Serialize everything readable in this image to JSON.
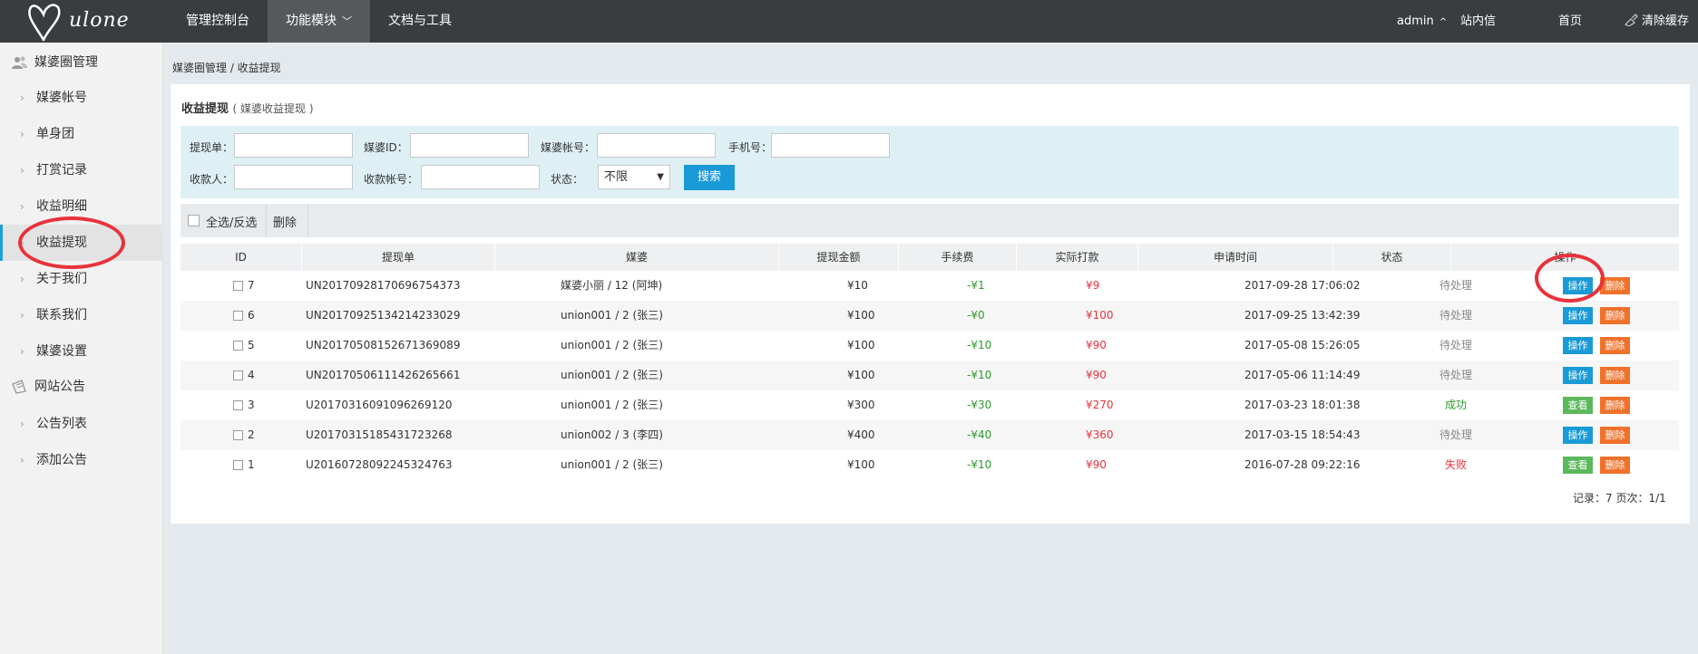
{
  "header": {
    "logo_text": "ulone",
    "nav": [
      {
        "label": "管理控制台"
      },
      {
        "label": "功能模块"
      },
      {
        "label": "文档与工具"
      }
    ],
    "user": "admin",
    "inbox": "站内信",
    "home": "首页",
    "clear_cache": "清除缓存"
  },
  "sidebar": {
    "group1": "媒婆圈管理",
    "items1": [
      {
        "label": "媒婆帐号"
      },
      {
        "label": "单身团"
      },
      {
        "label": "打赏记录"
      },
      {
        "label": "收益明细"
      },
      {
        "label": "收益提现"
      },
      {
        "label": "关于我们"
      },
      {
        "label": "联系我们"
      },
      {
        "label": "媒婆设置"
      }
    ],
    "group2": "网站公告",
    "items2": [
      {
        "label": "公告列表"
      },
      {
        "label": "添加公告"
      }
    ]
  },
  "breadcrumb": "媒婆圈管理 / 收益提现",
  "panel": {
    "title": "收益提现",
    "subtitle": "( 媒婆收益提现 )"
  },
  "filter": {
    "order_label": "提现单：",
    "id_label": "媒婆ID：",
    "account_label": "媒婆帐号：",
    "phone_label": "手机号：",
    "payee_label": "收款人：",
    "payee_account_label": "收款帐号：",
    "status_label": "状态：",
    "status_value": "不限",
    "search_label": "搜索"
  },
  "toolbar": {
    "select_all": "全选/反选",
    "delete": "删除"
  },
  "table": {
    "headers": [
      "ID",
      "提现单",
      "媒婆",
      "提现金额",
      "手续费",
      "实际打款",
      "申请时间",
      "状态",
      "操作"
    ],
    "rows": [
      {
        "id": "7",
        "order": "UN20170928170696754373",
        "matchmaker": "媒婆小丽 / 12 (阿坤)",
        "amount": "¥10",
        "fee": "-¥1",
        "paid": "¥9",
        "time": "2017-09-28 17:06:02",
        "status": "待处理",
        "action": "操作",
        "delete": "删除"
      },
      {
        "id": "6",
        "order": "UN20170925134214233029",
        "matchmaker": "union001 / 2 (张三)",
        "amount": "¥100",
        "fee": "-¥0",
        "paid": "¥100",
        "time": "2017-09-25 13:42:39",
        "status": "待处理",
        "action": "操作",
        "delete": "删除"
      },
      {
        "id": "5",
        "order": "UN20170508152671369089",
        "matchmaker": "union001 / 2 (张三)",
        "amount": "¥100",
        "fee": "-¥10",
        "paid": "¥90",
        "time": "2017-05-08 15:26:05",
        "status": "待处理",
        "action": "操作",
        "delete": "删除"
      },
      {
        "id": "4",
        "order": "UN20170506111426265661",
        "matchmaker": "union001 / 2 (张三)",
        "amount": "¥100",
        "fee": "-¥10",
        "paid": "¥90",
        "time": "2017-05-06 11:14:49",
        "status": "待处理",
        "action": "操作",
        "delete": "删除"
      },
      {
        "id": "3",
        "order": "U20170316091096269120",
        "matchmaker": "union001 / 2 (张三)",
        "amount": "¥300",
        "fee": "-¥30",
        "paid": "¥270",
        "time": "2017-03-23 18:01:38",
        "status": "成功",
        "action": "查看",
        "delete": "删除"
      },
      {
        "id": "2",
        "order": "U20170315185431723268",
        "matchmaker": "union002 / 3 (李四)",
        "amount": "¥400",
        "fee": "-¥40",
        "paid": "¥360",
        "time": "2017-03-15 18:54:43",
        "status": "待处理",
        "action": "操作",
        "delete": "删除"
      },
      {
        "id": "1",
        "order": "U20160728092245324763",
        "matchmaker": "union001 / 2 (张三)",
        "amount": "¥100",
        "fee": "-¥10",
        "paid": "¥90",
        "time": "2016-07-28 09:22:16",
        "status": "失败",
        "action": "查看",
        "delete": "删除"
      }
    ]
  },
  "pagination": "记录：7   页次：1/1",
  "colors": {
    "topbar": "#393d40",
    "accent_blue": "#1a9ad6",
    "green": "#5cb85c",
    "orange": "#f0712a",
    "red": "#e8323c"
  }
}
